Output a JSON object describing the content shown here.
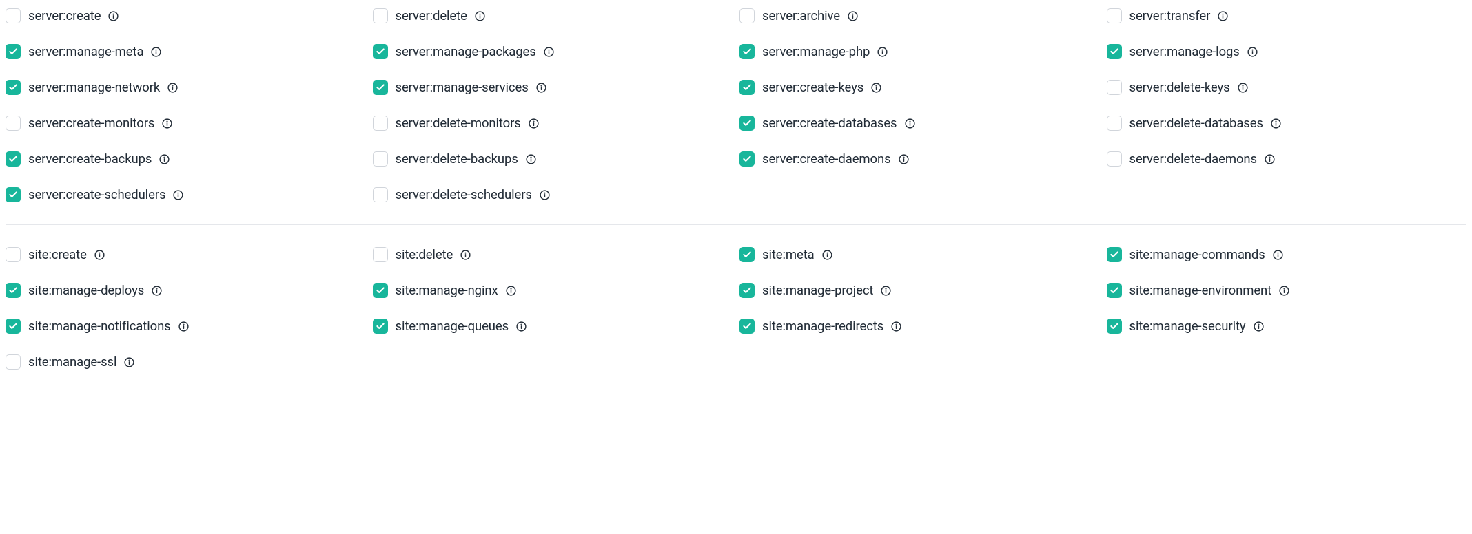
{
  "sections": [
    {
      "id": "server",
      "permissions": [
        {
          "label": "server:create",
          "checked": false
        },
        {
          "label": "server:delete",
          "checked": false
        },
        {
          "label": "server:archive",
          "checked": false
        },
        {
          "label": "server:transfer",
          "checked": false
        },
        {
          "label": "server:manage-meta",
          "checked": true
        },
        {
          "label": "server:manage-packages",
          "checked": true
        },
        {
          "label": "server:manage-php",
          "checked": true
        },
        {
          "label": "server:manage-logs",
          "checked": true
        },
        {
          "label": "server:manage-network",
          "checked": true
        },
        {
          "label": "server:manage-services",
          "checked": true
        },
        {
          "label": "server:create-keys",
          "checked": true
        },
        {
          "label": "server:delete-keys",
          "checked": false
        },
        {
          "label": "server:create-monitors",
          "checked": false
        },
        {
          "label": "server:delete-monitors",
          "checked": false
        },
        {
          "label": "server:create-databases",
          "checked": true
        },
        {
          "label": "server:delete-databases",
          "checked": false
        },
        {
          "label": "server:create-backups",
          "checked": true
        },
        {
          "label": "server:delete-backups",
          "checked": false
        },
        {
          "label": "server:create-daemons",
          "checked": true
        },
        {
          "label": "server:delete-daemons",
          "checked": false
        },
        {
          "label": "server:create-schedulers",
          "checked": true
        },
        {
          "label": "server:delete-schedulers",
          "checked": false
        }
      ]
    },
    {
      "id": "site",
      "permissions": [
        {
          "label": "site:create",
          "checked": false
        },
        {
          "label": "site:delete",
          "checked": false
        },
        {
          "label": "site:meta",
          "checked": true
        },
        {
          "label": "site:manage-commands",
          "checked": true
        },
        {
          "label": "site:manage-deploys",
          "checked": true
        },
        {
          "label": "site:manage-nginx",
          "checked": true
        },
        {
          "label": "site:manage-project",
          "checked": true
        },
        {
          "label": "site:manage-environment",
          "checked": true
        },
        {
          "label": "site:manage-notifications",
          "checked": true
        },
        {
          "label": "site:manage-queues",
          "checked": true
        },
        {
          "label": "site:manage-redirects",
          "checked": true
        },
        {
          "label": "site:manage-security",
          "checked": true
        },
        {
          "label": "site:manage-ssl",
          "checked": false
        }
      ]
    }
  ]
}
